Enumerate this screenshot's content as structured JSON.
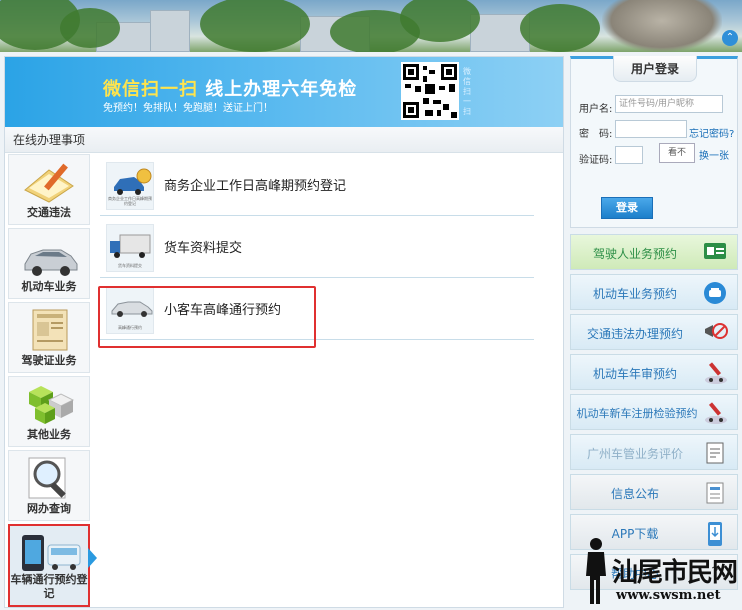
{
  "promo": {
    "title_part1": "微信扫一扫",
    "title_part2": "线上办理六年免检",
    "subtitle": "免预约！免排队！免跑腿！送证上门！",
    "side_text": "微信扫一扫"
  },
  "section": {
    "title": "在线办理事项"
  },
  "categories": [
    {
      "label": "交通违法",
      "icon": "pen-doc-icon"
    },
    {
      "label": "机动车业务",
      "icon": "car-icon"
    },
    {
      "label": "驾驶证业务",
      "icon": "license-card-icon"
    },
    {
      "label": "其他业务",
      "icon": "cubes-icon"
    },
    {
      "label": "网办查询",
      "icon": "magnifier-icon"
    },
    {
      "label": "车辆通行预约登记",
      "icon": "phone-bus-icon",
      "active": true
    }
  ],
  "services": [
    {
      "title": "商务企业工作日高峰期预约登记",
      "thumb_caption": "商务企业工作日高峰期预约登记"
    },
    {
      "title": "货车资料提交",
      "thumb_caption": "货车资料提交"
    },
    {
      "title": "小客车高峰通行预约",
      "thumb_caption": "高峰通行预约",
      "highlighted": true
    }
  ],
  "login": {
    "title": "用户登录",
    "username_label": "用户名:",
    "username_placeholder": "证件号码/用户昵称",
    "password_label": "密　码:",
    "forgot_link": "忘记密码?",
    "captcha_label": "验证码:",
    "captcha_image_text": "看不",
    "change_link": "换一张",
    "login_button": "登录"
  },
  "sidebar_buttons": [
    {
      "label": "驾驶人业务预约",
      "style": "green",
      "icon": "id-card-icon"
    },
    {
      "label": "机动车业务预约",
      "style": "blue",
      "icon": "car-front-icon"
    },
    {
      "label": "交通违法办理预约",
      "style": "blue",
      "icon": "no-entry-icon"
    },
    {
      "label": "机动车年审预约",
      "style": "blue",
      "icon": "inspection-icon"
    },
    {
      "label": "机动车新车注册检验预约",
      "style": "blue",
      "icon": "new-car-icon"
    },
    {
      "label": "广州车管业务评价",
      "style": "blue",
      "icon": "edit-doc-icon"
    },
    {
      "label": "信息公布",
      "style": "grey",
      "icon": "notice-doc-icon"
    },
    {
      "label": "APP下载",
      "style": "grey",
      "icon": "phone-download-icon"
    },
    {
      "label": "帮助中心",
      "style": "grey",
      "icon": "help-icon"
    }
  ],
  "watermark": {
    "text": "汕尾市民网",
    "url": "www.swsm.net"
  },
  "colors": {
    "accent_blue": "#2a9ae0",
    "highlight_red": "#e03030",
    "link_blue": "#1a6fb8"
  }
}
